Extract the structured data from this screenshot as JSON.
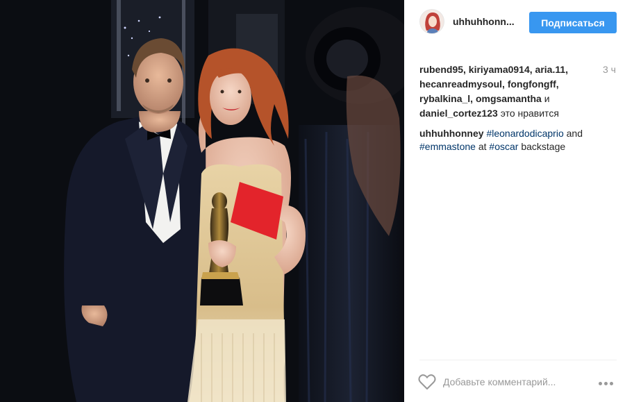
{
  "post": {
    "image_icon": "photo",
    "author": {
      "username": "uhhuhhonn...",
      "avatar_icon": "avatar-icon"
    },
    "follow_label": "Подписаться",
    "likes": {
      "users": [
        "rubend95",
        "kiriyama0914",
        "aria.11",
        "hecanreadmysoul",
        "fongfongff",
        "rybalkina_l",
        "omgsamantha",
        "daniel_cortez123"
      ],
      "line1": "rubend95, kiriyama0914, aria.11,",
      "line2": "hecanreadmysoul, fongfongff,",
      "line3_user1": "rybalkina_l",
      "line3_sep": ", ",
      "line3_user2": "omgsamantha",
      "line3_and": " и",
      "line4_user": "daniel_cortez123",
      "line4_suffix": " это нравится"
    },
    "time": "3 ч",
    "caption": {
      "username": "uhhuhhonney",
      "tag1": "#leonardodicaprio",
      "and": " and",
      "tag2": "#emmastone",
      "at": " at ",
      "tag3": "#oscar",
      "tail": " backstage"
    },
    "comment_placeholder": "Добавьте комментарий...",
    "colors": {
      "accent": "#3897f0",
      "hashtag": "#003569",
      "muted": "#999999",
      "divider": "#efefef"
    }
  }
}
